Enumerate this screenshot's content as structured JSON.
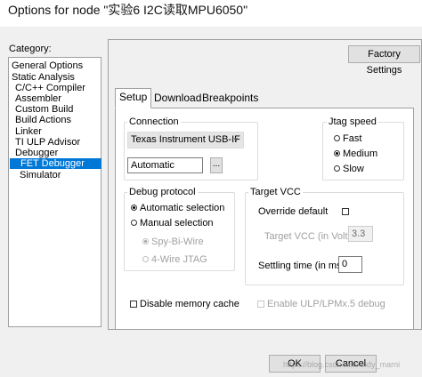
{
  "window": {
    "title": "Options for node \"实验6 I2C读取MPU6050\""
  },
  "category": {
    "label": "Category:",
    "items": [
      {
        "label": "General Options"
      },
      {
        "label": "Static Analysis"
      },
      {
        "label": "C/C++ Compiler"
      },
      {
        "label": "Assembler"
      },
      {
        "label": "Custom Build"
      },
      {
        "label": "Build Actions"
      },
      {
        "label": "Linker"
      },
      {
        "label": "TI ULP Advisor"
      },
      {
        "label": "Debugger"
      },
      {
        "label": "FET Debugger"
      },
      {
        "label": "Simulator"
      }
    ],
    "selected": "FET Debugger"
  },
  "factory_settings": "Factory Settings",
  "tabs": [
    {
      "label": "Setup"
    },
    {
      "label": "Download"
    },
    {
      "label": "Breakpoints"
    }
  ],
  "active_tab": "Setup",
  "connection": {
    "title": "Connection",
    "selected": "Texas Instrument USB-IF",
    "port_value": "Automatic",
    "browse_label": "..."
  },
  "jtag_speed": {
    "title": "Jtag speed",
    "options": [
      {
        "label": "Fast"
      },
      {
        "label": "Medium"
      },
      {
        "label": "Slow"
      }
    ],
    "selected": "Medium"
  },
  "debug_protocol": {
    "title": "Debug protocol",
    "automatic": "Automatic selection",
    "manual": "Manual selection",
    "spy_bi_wire": "Spy-Bi-Wire",
    "four_wire": "4-Wire JTAG",
    "selected": "Automatic selection"
  },
  "target_vcc": {
    "title": "Target VCC",
    "override_label": "Override default",
    "override_checked": false,
    "vcc_label": "Target VCC (in Volt):",
    "vcc_value": "3.3",
    "settling_label": "Settling time (in ms):",
    "settling_value": "0"
  },
  "disable_memory_cache": {
    "label": "Disable memory cache",
    "checked": false
  },
  "enable_ulp": {
    "label": "Enable ULP/LPMx.5 debug",
    "checked": false
  },
  "buttons": {
    "ok": "OK",
    "cancel": "Cancel"
  },
  "watermark": "https://blog.csdn.net/Andy_marni"
}
